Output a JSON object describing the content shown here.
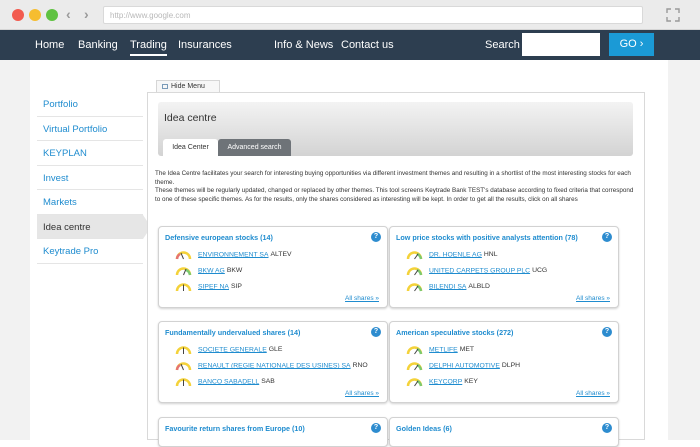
{
  "browser": {
    "url": "http://www.google.com"
  },
  "topnav": {
    "items": [
      "Home",
      "Banking",
      "Trading",
      "Insurances",
      "Info & News",
      "Contact us"
    ],
    "active": "Trading",
    "search_label": "Search",
    "search_value": "",
    "go_label": "GO",
    "go_arrow": "›"
  },
  "sidebar": {
    "items": [
      "Portfolio",
      "Virtual Portfolio",
      "KEYPLAN",
      "Invest",
      "Markets",
      "Idea centre",
      "Keytrade Pro"
    ],
    "active": "Idea centre"
  },
  "hide_menu": "Hide Menu",
  "idea": {
    "title": "Idea centre",
    "tabs": [
      "Idea Center",
      "Advanced search"
    ],
    "intro1": "The Idea Centre facilitates your search for interesting buying opportunities via different investment themes and resulting in a shortlist of the most interesting stocks for each theme.",
    "intro2": "These themes will be regularly updated, changed or replaced by other themes. This tool screens Keytrade Bank TEST's database according to fixed criteria that correspond to one of these specific themes. As for the results, only the shares considered as interesting will be kept. In order to get all the results, click on all shares"
  },
  "cards": [
    {
      "title": "Defensive european stocks (14)",
      "stocks": [
        {
          "name": "ENVIRONNEMENT SA",
          "code": "ALTEV"
        },
        {
          "name": "BKW AG",
          "code": "BKW"
        },
        {
          "name": "SIPEF NA",
          "code": "SIP"
        }
      ],
      "all": "All shares »"
    },
    {
      "title": "Low price stocks with positive analysts attention (78)",
      "stocks": [
        {
          "name": "DR. HOENLE AG",
          "code": "HNL"
        },
        {
          "name": "UNITED CARPETS GROUP PLC",
          "code": "UCG"
        },
        {
          "name": "BILENDI SA",
          "code": "ALBLD"
        }
      ],
      "all": "All shares »"
    },
    {
      "title": "Fundamentally undervalued shares (14)",
      "stocks": [
        {
          "name": "SOCIETE GENERALE",
          "code": "GLE"
        },
        {
          "name": "RENAULT (REGIE NATIONALE DES USINES) SA",
          "code": "RNO"
        },
        {
          "name": "BANCO SABADELL",
          "code": "SAB"
        }
      ],
      "all": "All shares »"
    },
    {
      "title": "American speculative stocks (272)",
      "stocks": [
        {
          "name": "METLIFE",
          "code": "MET"
        },
        {
          "name": "DELPHI AUTOMOTIVE",
          "code": "DLPH"
        },
        {
          "name": "KEYCORP",
          "code": "KEY"
        }
      ],
      "all": "All shares »"
    },
    {
      "title": "Favourite return shares from Europe (10)",
      "stocks": [],
      "all": ""
    },
    {
      "title": "Golden Ideas (6)",
      "stocks": [],
      "all": ""
    }
  ],
  "help_glyph": "?",
  "colors": {
    "nav_bg": "#2d3e50",
    "accent": "#1f8ccf",
    "go_button": "#1b9ad6"
  },
  "icons": {
    "back": "‹",
    "forward": "›",
    "help": "help-icon",
    "gauge": "gauge-icon"
  }
}
